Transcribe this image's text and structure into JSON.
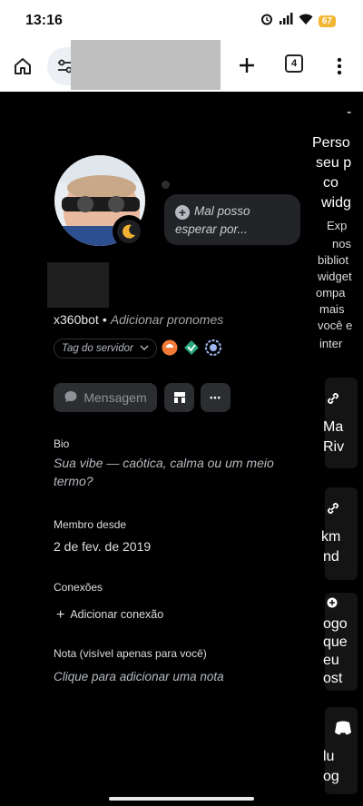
{
  "status_bar": {
    "time": "13:16",
    "battery": "67"
  },
  "browser": {
    "tab_count": "4"
  },
  "profile": {
    "custom_status": "Mal posso esperar por...",
    "username": "x360bot",
    "separator": "•",
    "pronouns_prompt": "Adicionar pronomes",
    "server_tag": "Tag do servidor",
    "message_button": "Mensagem",
    "more_glyph": "•••",
    "bio_label": "Bio",
    "bio_text": "Sua vibe — caótica, calma ou um meio termo?",
    "member_since_label": "Membro desde",
    "member_since_value": "2 de fev. de 2019",
    "connections_label": "Conexões",
    "add_connection": "Adicionar conexão",
    "note_label": "Nota (visível apenas para você)",
    "note_placeholder": "Clique para adicionar uma nota"
  },
  "side_panel": {
    "lines": [
      "Perso",
      "seu p",
      "co",
      "widg",
      "Exp",
      "nos",
      "bibliot",
      "widget",
      "ompa",
      "mais",
      "você e",
      "inter"
    ],
    "card1": [
      "Ma",
      "Riv"
    ],
    "card2": [
      "km",
      "nd"
    ],
    "card3": [
      "ogo",
      "que",
      "eu",
      "ost"
    ],
    "card4": [
      "lu",
      "og"
    ]
  },
  "colors": {
    "background": "#000000",
    "surface": "#2b2d31",
    "accent_moon": "#f0b232",
    "muted_text": "#b5bac1"
  }
}
